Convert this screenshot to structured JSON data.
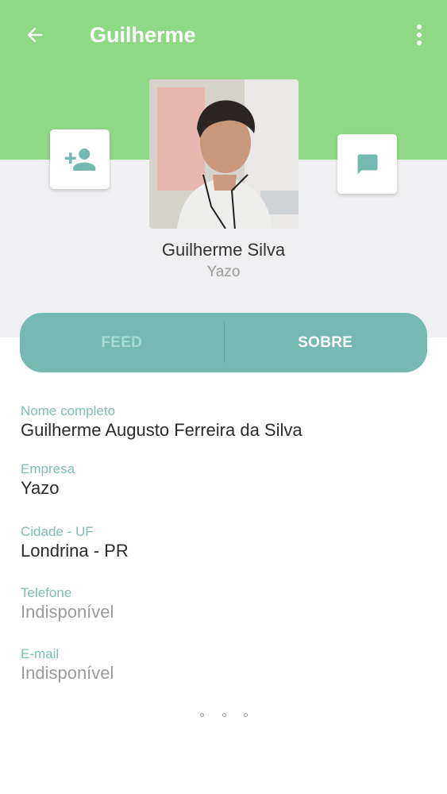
{
  "app_bar": {
    "title": "Guilherme",
    "back_icon": "arrow-left-icon",
    "menu_icon": "more-vertical-icon"
  },
  "actions": {
    "add_contact_icon": "person-add-icon",
    "message_icon": "chat-bubble-icon"
  },
  "profile": {
    "name": "Guilherme Silva",
    "company": "Yazo"
  },
  "tabs": [
    {
      "label": "FEED",
      "active": false
    },
    {
      "label": "SOBRE",
      "active": true
    }
  ],
  "details": [
    {
      "label": "Nome completo",
      "value": "Guilherme Augusto Ferreira da Silva",
      "available": true
    },
    {
      "label": "Empresa",
      "value": "Yazo",
      "available": true
    },
    {
      "label": "Cidade - UF",
      "value": "Londrina - PR",
      "available": true
    },
    {
      "label": "Telefone",
      "value": "Indisponível",
      "available": false
    },
    {
      "label": "E-mail",
      "value": "Indisponível",
      "available": false
    }
  ],
  "colors": {
    "header_green": "#8fd986",
    "accent_teal": "#76b9b0",
    "label_teal": "#7ebdb3"
  }
}
